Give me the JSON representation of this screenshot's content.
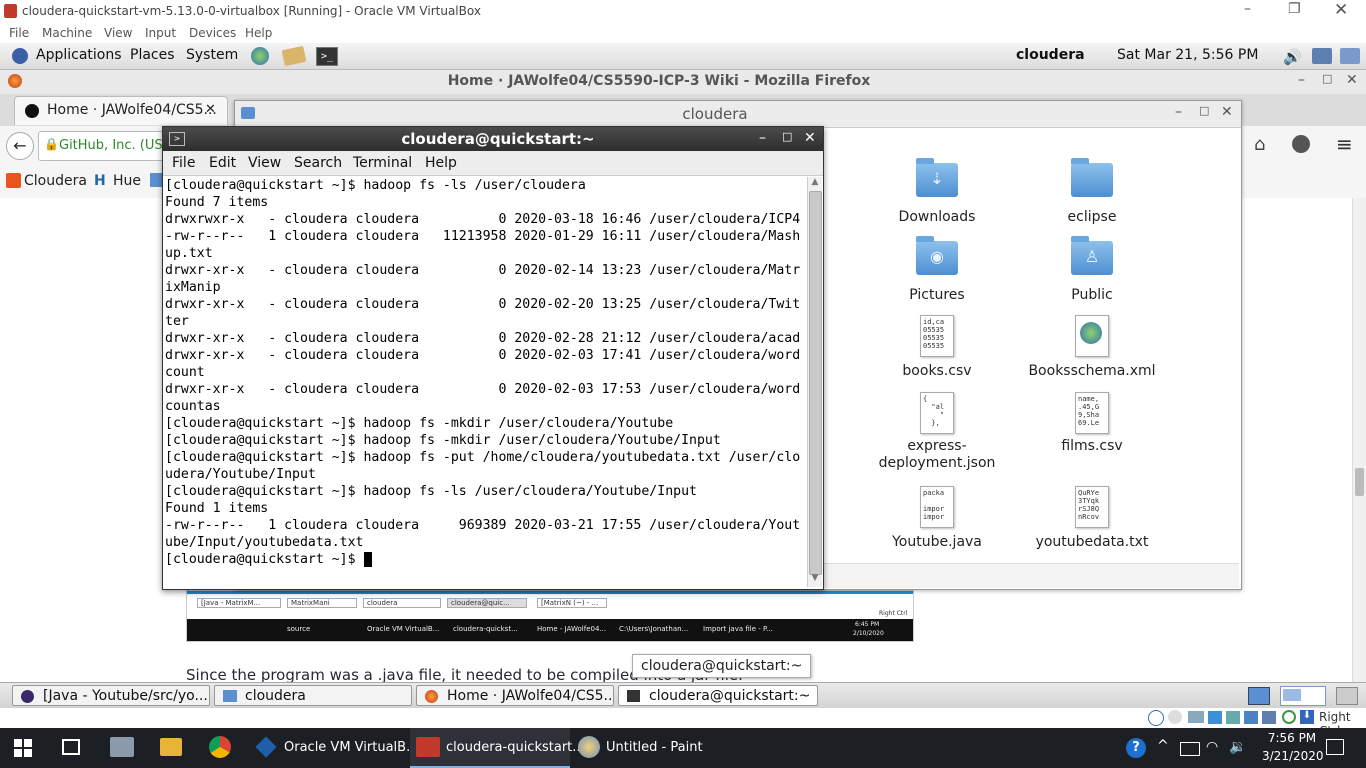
{
  "vbox": {
    "window_title": "cloudera-quickstart-vm-5.13.0-0-virtualbox [Running] - Oracle VM VirtualBox",
    "menu": [
      "File",
      "Machine",
      "View",
      "Input",
      "Devices",
      "Help"
    ],
    "host_key": "Right Ctrl"
  },
  "gnome_panel": {
    "menus": [
      "Applications",
      "Places",
      "System"
    ],
    "user": "cloudera",
    "clock": "Sat Mar 21,  5:56 PM"
  },
  "firefox": {
    "window_title": "Home · JAWolfe04/CS5590-ICP-3 Wiki - Mozilla Firefox",
    "tab_label": "Home · JAWolfe04/CS5...",
    "identity": "GitHub, Inc. (US)",
    "bookmarks": [
      "Cloudera",
      "Hue"
    ],
    "page_text": "Since the program was a .java file, it needed to be compiled into a jar file.",
    "tooltip": "cloudera@quickstart:~",
    "embedded_fragment": "on"
  },
  "file_manager": {
    "title": "cloudera",
    "items": [
      {
        "name": "Downloads",
        "kind": "folder",
        "icon": "download-icon"
      },
      {
        "name": "eclipse",
        "kind": "folder",
        "icon": "folder-icon"
      },
      {
        "name": "Pictures",
        "kind": "folder",
        "icon": "camera-icon"
      },
      {
        "name": "Public",
        "kind": "folder",
        "icon": "person-icon"
      },
      {
        "name": "books.csv",
        "kind": "file",
        "preview": "id,ca\n05535\n05535\n05535"
      },
      {
        "name": "Booksschema.xml",
        "kind": "file",
        "icon": "globe-icon"
      },
      {
        "name": "express-\ndeployment.json",
        "kind": "file",
        "preview": "{\n  \"al\n    \"\n  },"
      },
      {
        "name": "films.csv",
        "kind": "file",
        "preview": "name,\n.45,G\n9,Sha\n69.Le"
      },
      {
        "name": "Youtube.java",
        "kind": "file",
        "preview": "packa\n\nimpor\nimpor"
      },
      {
        "name": "youtubedata.txt",
        "kind": "file",
        "preview": "QuRYe\n3TYqk\nrSJ8Q\nnRcov"
      }
    ]
  },
  "terminal": {
    "title": "cloudera@quickstart:~",
    "menu": [
      "File",
      "Edit",
      "View",
      "Search",
      "Terminal",
      "Help"
    ],
    "lines": [
      "[cloudera@quickstart ~]$ hadoop fs -ls /user/cloudera",
      "Found 7 items",
      "drwxrwxr-x   - cloudera cloudera          0 2020-03-18 16:46 /user/cloudera/ICP4",
      "-rw-r--r--   1 cloudera cloudera   11213958 2020-01-29 16:11 /user/cloudera/Mash",
      "up.txt",
      "drwxr-xr-x   - cloudera cloudera          0 2020-02-14 13:23 /user/cloudera/Matr",
      "ixManip",
      "drwxr-xr-x   - cloudera cloudera          0 2020-02-20 13:25 /user/cloudera/Twit",
      "ter",
      "drwxr-xr-x   - cloudera cloudera          0 2020-02-28 21:12 /user/cloudera/acad",
      "drwxr-xr-x   - cloudera cloudera          0 2020-02-03 17:41 /user/cloudera/word",
      "count",
      "drwxr-xr-x   - cloudera cloudera          0 2020-02-03 17:53 /user/cloudera/word",
      "countas",
      "[cloudera@quickstart ~]$ hadoop fs -mkdir /user/cloudera/Youtube",
      "[cloudera@quickstart ~]$ hadoop fs -mkdir /user/cloudera/Youtube/Input",
      "[cloudera@quickstart ~]$ hadoop fs -put /home/cloudera/youtubedata.txt /user/clo",
      "udera/Youtube/Input",
      "[cloudera@quickstart ~]$ hadoop fs -ls /user/cloudera/Youtube/Input",
      "Found 1 items",
      "-rw-r--r--   1 cloudera cloudera     969389 2020-03-21 17:55 /user/cloudera/Yout",
      "ube/Input/youtubedata.txt",
      "[cloudera@quickstart ~]$ "
    ]
  },
  "embedded_screenshot": {
    "tabs": [
      "[Java - MatrixM...",
      "MatrixMani",
      "cloudera",
      "cloudera@quic...",
      "[MatrixN (~) - ..."
    ],
    "taskbar": [
      "source",
      "Oracle VM VirtualB...",
      "cloudera-quickst...",
      "Home - JAWolfe04...",
      "C:\\Users\\Jonathan...",
      "Import java file - P..."
    ],
    "clock_time": "6:45 PM",
    "clock_date": "2/10/2020",
    "host_key": "Right Ctrl"
  },
  "guest_taskbar": [
    "[Java - Youtube/src/yo...",
    "cloudera",
    "Home · JAWolfe04/CS5...",
    "cloudera@quickstart:~"
  ],
  "windows_taskbar": {
    "items": [
      "Oracle VM VirtualB...",
      "cloudera-quickstart...",
      "Untitled - Paint"
    ],
    "time": "7:56 PM",
    "date": "3/21/2020"
  },
  "colors": {
    "terminal_title": "#2e2e2e",
    "folder": "#4d8fd1",
    "win_taskbar": "#1c1f24",
    "accent": "#7fb2e8"
  }
}
